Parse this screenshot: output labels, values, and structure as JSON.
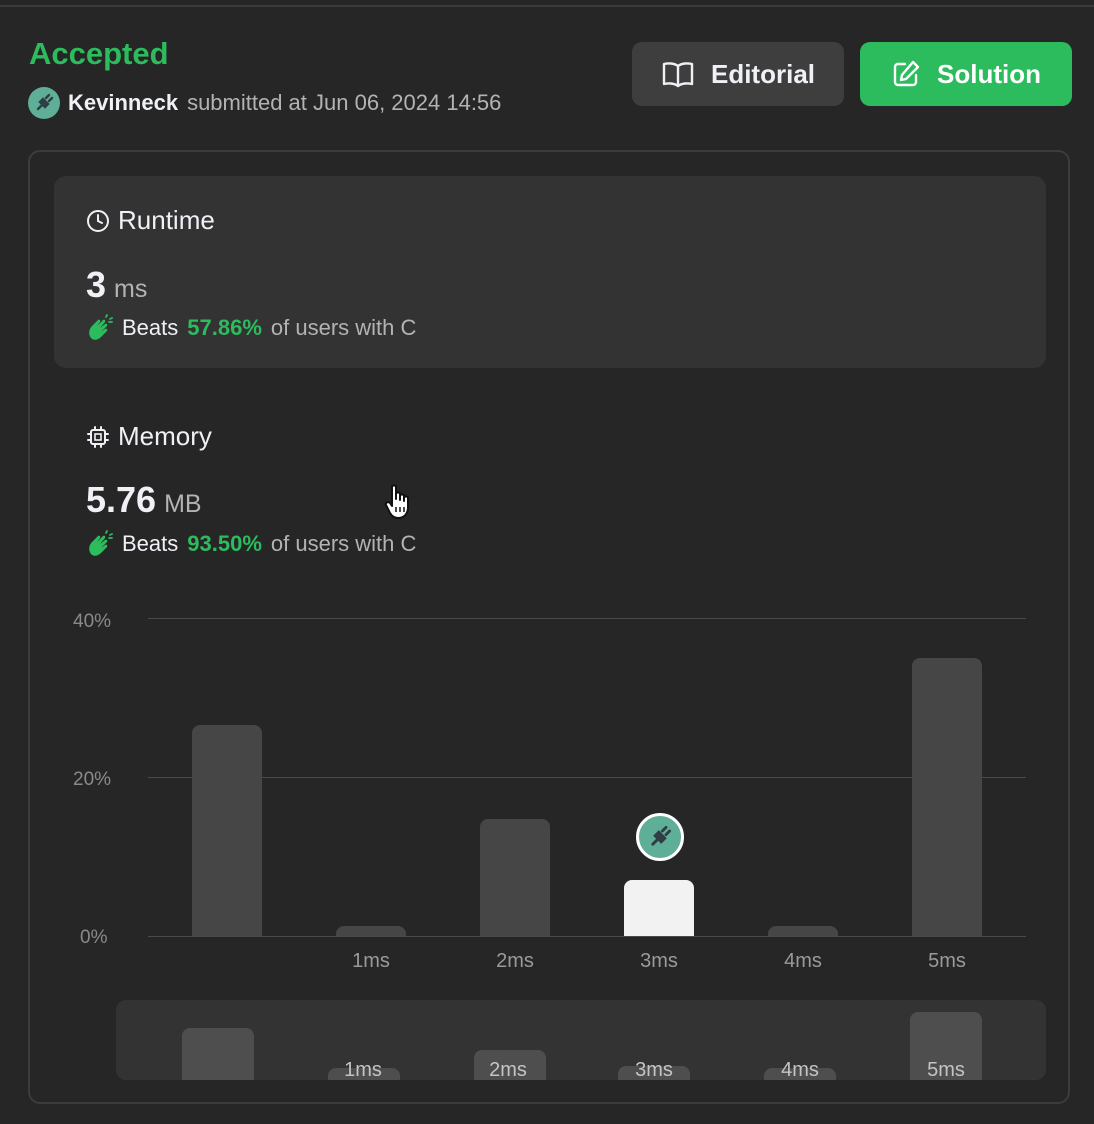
{
  "header": {
    "status": "Accepted",
    "username": "Kevinneck",
    "submitted_text": "submitted at Jun 06, 2024 14:56"
  },
  "buttons": {
    "editorial": "Editorial",
    "solution": "Solution"
  },
  "runtime": {
    "title": "Runtime",
    "value": "3",
    "unit": "ms",
    "beats_label": "Beats",
    "beats_pct": "57.86%",
    "beats_suffix": "of users with C"
  },
  "memory": {
    "title": "Memory",
    "value": "5.76",
    "unit": "MB",
    "beats_label": "Beats",
    "beats_pct": "93.50%",
    "beats_suffix": "of users with C"
  },
  "colors": {
    "accent_green": "#2cbb5d",
    "background": "#262626",
    "card": "#333333",
    "bar": "#464646",
    "current_bar": "#f2f2f2"
  },
  "icons": [
    "book-open-icon",
    "edit-icon",
    "clock-icon",
    "chip-icon",
    "clap-icon",
    "avatar-icon",
    "pointer-cursor-icon"
  ],
  "chart_data": {
    "type": "bar",
    "categories": [
      "",
      "1ms",
      "2ms",
      "3ms",
      "4ms",
      "5ms"
    ],
    "values": [
      26.5,
      1.3,
      14.7,
      7.1,
      1.3,
      35.0
    ],
    "y_ticks": [
      "40%",
      "20%",
      "0%"
    ],
    "ylim": [
      0,
      40
    ],
    "highlight_category": "3ms",
    "grid": true
  },
  "minimap": {
    "labels": [
      "",
      "1ms",
      "2ms",
      "3ms",
      "4ms",
      "5ms"
    ]
  }
}
